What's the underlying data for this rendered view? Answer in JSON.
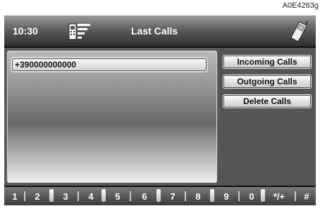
{
  "figure_code": "A0E4263g",
  "header": {
    "time": "10:30",
    "title": "Last Calls"
  },
  "calls": [
    {
      "number": "+390000000000"
    }
  ],
  "menu": {
    "incoming": "Incoming Calls",
    "outgoing": "Outgoing Calls",
    "delete": "Delete Calls"
  },
  "keypad": {
    "keys": [
      "1",
      "2",
      "3",
      "4",
      "5",
      "6",
      "7",
      "8",
      "9",
      "0",
      "*/+",
      "#"
    ]
  },
  "icons": {
    "phone": "cellphone-signal-icon",
    "handset": "handset-icon"
  }
}
